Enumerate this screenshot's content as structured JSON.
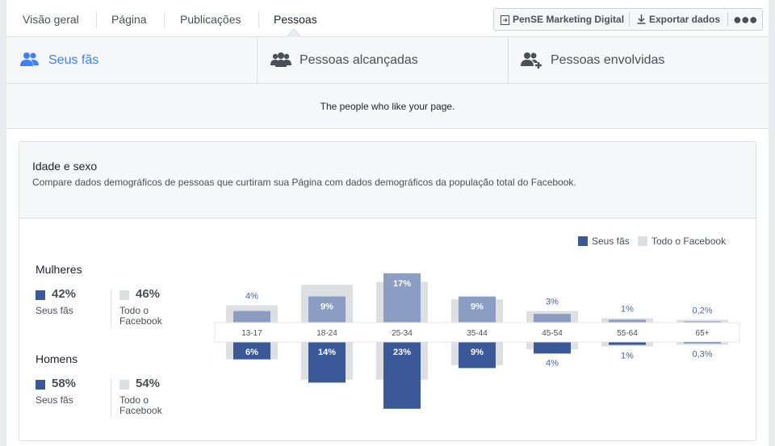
{
  "topnav": {
    "tabs": [
      {
        "label": "Visão geral"
      },
      {
        "label": "Página"
      },
      {
        "label": "Publicações"
      },
      {
        "label": "Pessoas",
        "active": true
      }
    ]
  },
  "actions": {
    "page_button": "PenSE Marketing Digital",
    "export_button": "Exportar dados",
    "more_icon": "more-dots-icon"
  },
  "subtabs": [
    {
      "label": "Seus fãs",
      "icon": "people-icon",
      "active": true
    },
    {
      "label": "Pessoas alcançadas",
      "icon": "group-icon"
    },
    {
      "label": "Pessoas envolvidas",
      "icon": "add-group-icon"
    }
  ],
  "description": "The people who like your page.",
  "card": {
    "title": "Idade e sexo",
    "subtitle": "Compare dados demográficos de pessoas que curtiram sua Página com dados demográficos da população total do Facebook."
  },
  "colors": {
    "fans_women": "#8b9dc3",
    "fans_men": "#3b5998",
    "facebook": "#dddfe2",
    "label_blue": "#4a63a7"
  },
  "women": {
    "title": "Mulheres",
    "fans_pct": "42%",
    "fans_label": "Seus fãs",
    "fb_pct": "46%",
    "fb_label": "Todo o Facebook"
  },
  "men": {
    "title": "Homens",
    "fans_pct": "58%",
    "fans_label": "Seus fãs",
    "fb_pct": "54%",
    "fb_label": "Todo o Facebook"
  },
  "chart_data": {
    "type": "bar",
    "legend": [
      "Seus fãs",
      "Todo o Facebook"
    ],
    "legend_position": "top-right",
    "categories": [
      "13-17",
      "18-24",
      "25-34",
      "35-44",
      "45-54",
      "55-64",
      "65+"
    ],
    "series": [
      {
        "name": "Seus fãs",
        "group": "Mulheres",
        "values": [
          4,
          9,
          17,
          9,
          3,
          1,
          0.2
        ],
        "labels": [
          "4%",
          "9%",
          "17%",
          "9%",
          "3%",
          "1%",
          "0,2%"
        ]
      },
      {
        "name": "Seus fãs",
        "group": "Homens",
        "values": [
          6,
          14,
          23,
          9,
          4,
          1,
          0.3
        ],
        "labels": [
          "6%",
          "14%",
          "23%",
          "9%",
          "4%",
          "1%",
          "0,3%"
        ]
      },
      {
        "name": "Todo o Facebook",
        "group": "Mulheres",
        "values": [
          6,
          13,
          14,
          8,
          4,
          1.5,
          1
        ]
      },
      {
        "name": "Todo o Facebook",
        "group": "Homens",
        "values": [
          6,
          13,
          13,
          8,
          2.5,
          1.5,
          1
        ]
      }
    ]
  }
}
